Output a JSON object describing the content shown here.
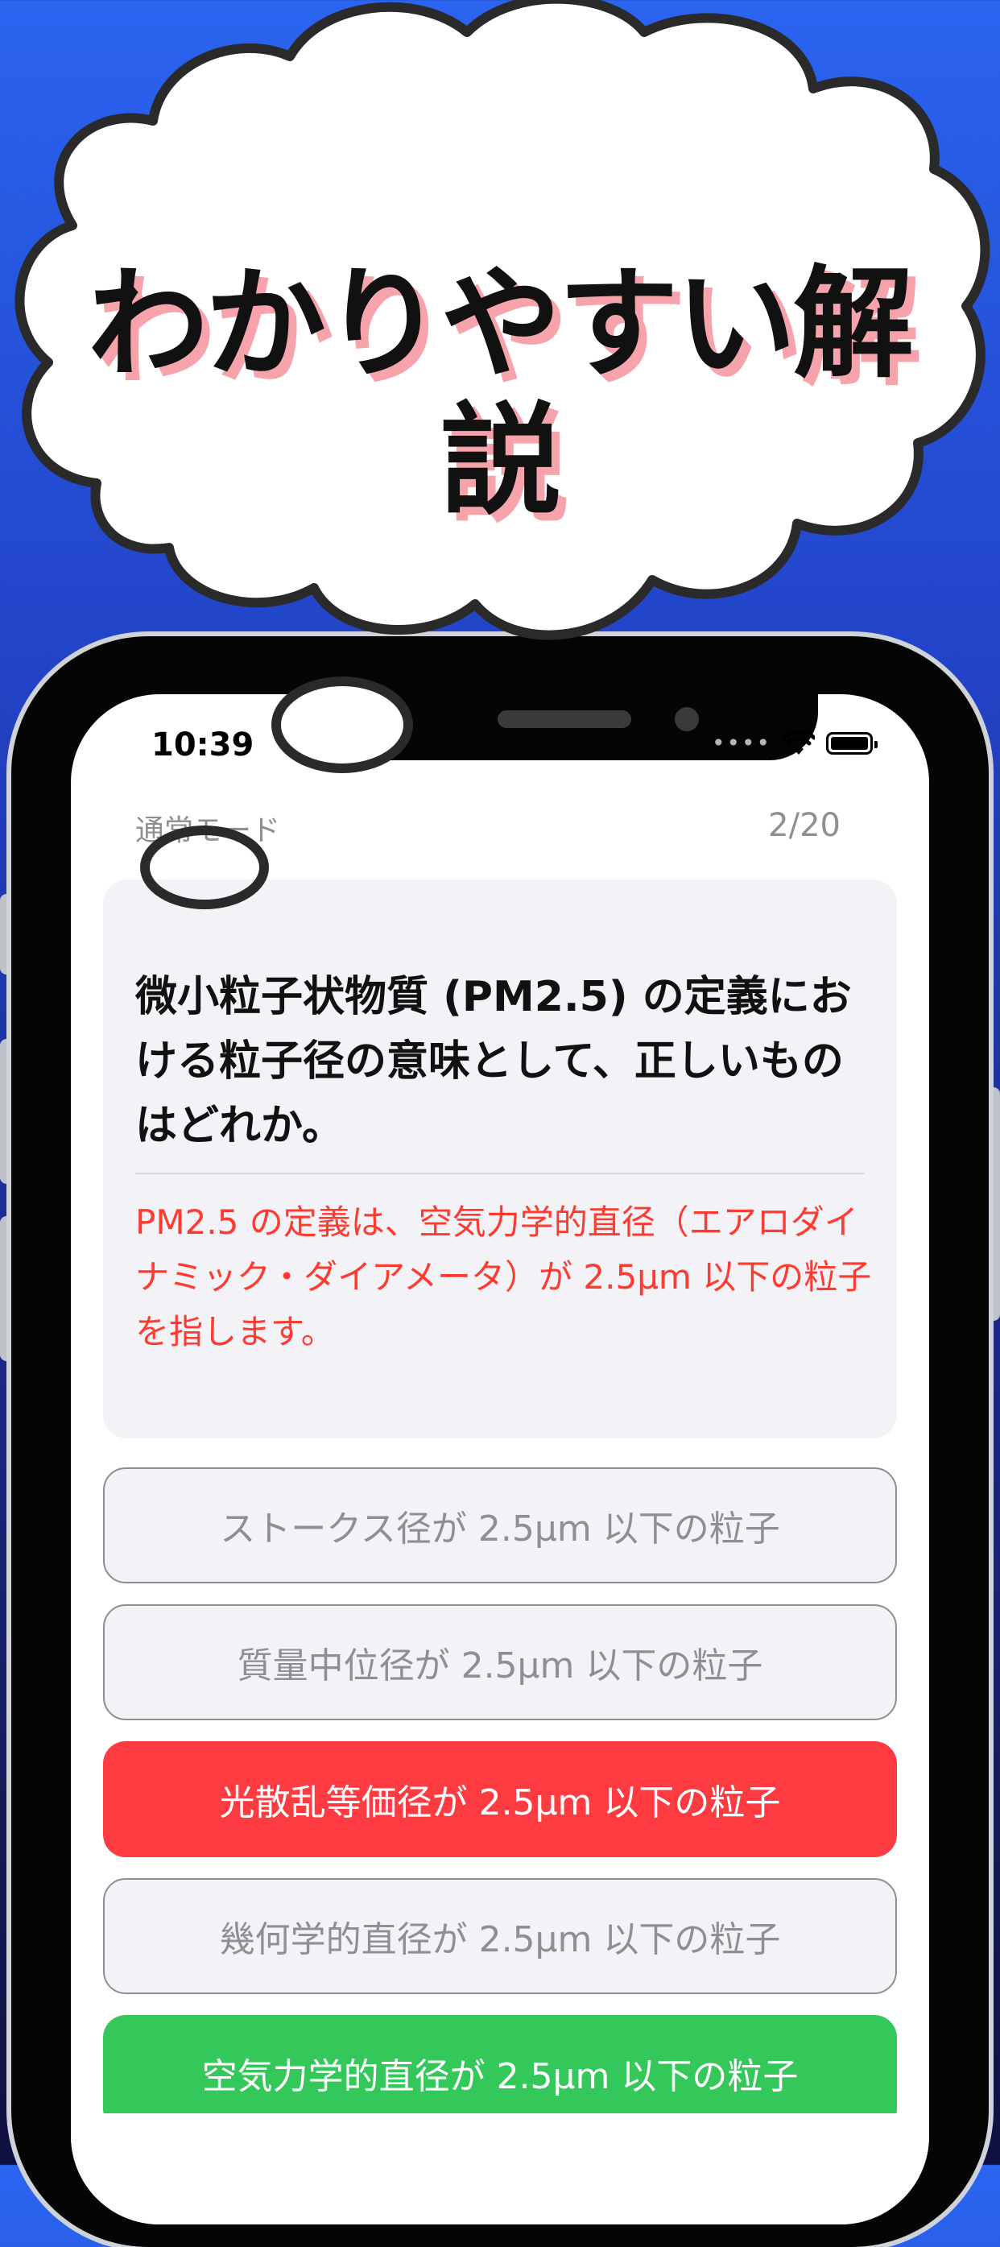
{
  "banner": {
    "headline": "わかりやすい解説"
  },
  "status_bar": {
    "time": "10:39"
  },
  "quiz": {
    "mode": "通常モード",
    "progress": "2/20",
    "question": "微小粒子状物質 (PM2.5) の定義における粒子径の意味として、正しいものはどれか。",
    "explanation": "PM2.5 の定義は、空気力学的直径（エアロダイナミック・ダイアメータ）が 2.5μm 以下の粒子を指します。",
    "options": [
      {
        "label": "ストークス径が 2.5μm 以下の粒子",
        "state": "neutral"
      },
      {
        "label": "質量中位径が 2.5μm 以下の粒子",
        "state": "neutral"
      },
      {
        "label": "光散乱等価径が 2.5μm 以下の粒子",
        "state": "wrong"
      },
      {
        "label": "幾何学的直径が 2.5μm 以下の粒子",
        "state": "neutral"
      },
      {
        "label": "空気力学的直径が 2.5μm 以下の粒子",
        "state": "correct"
      }
    ]
  },
  "colors": {
    "wrong": "#ff3b42",
    "correct": "#34c759",
    "explanation": "#ff3b30",
    "background_top": "#2a64f0",
    "background_bottom": "#101040"
  }
}
